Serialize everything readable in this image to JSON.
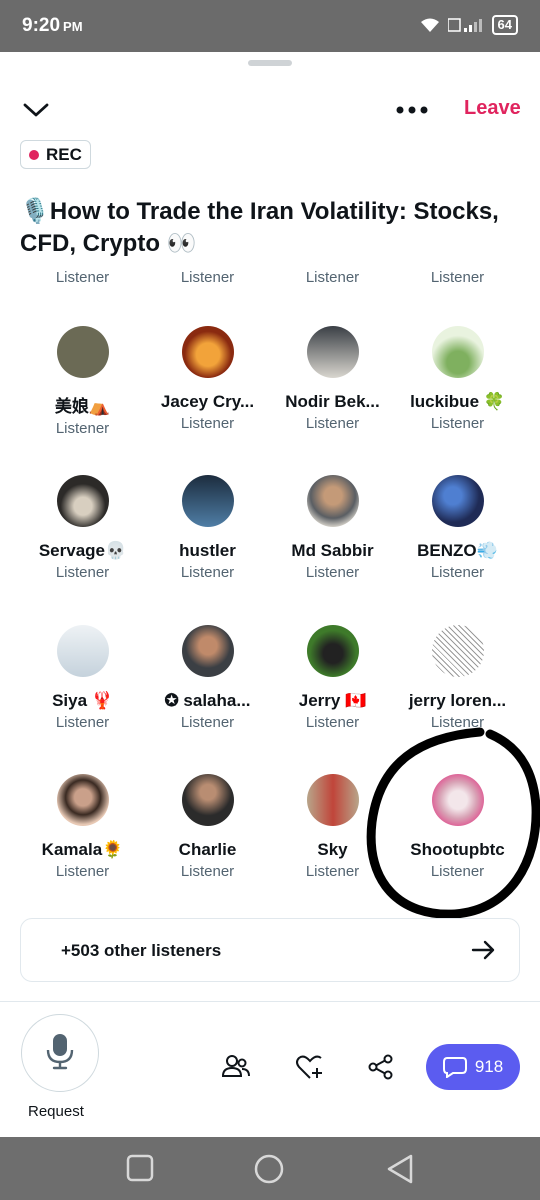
{
  "status": {
    "time": "9:20",
    "ampm": "PM",
    "battery": "64"
  },
  "header": {
    "leave_label": "Leave",
    "rec_label": "REC"
  },
  "space": {
    "title": "🎙️How to Trade the Iran Volatility: Stocks, CFD, Crypto 👀"
  },
  "partial_roles": [
    "Listener",
    "Listener",
    "Listener",
    "Listener"
  ],
  "listeners": [
    {
      "name": "美娘⛺",
      "role": "Listener",
      "color": "#6b6a55"
    },
    {
      "name": "Jacey Cry...",
      "role": "Listener",
      "color": "#8a2a10"
    },
    {
      "name": "Nodir Bek...",
      "role": "Listener",
      "color": "#3a3f45"
    },
    {
      "name": "luckibue 🍀",
      "role": "Listener",
      "color": "#c9e3b5"
    },
    {
      "name": "Servage💀",
      "role": "Listener",
      "color": "#2c2a28"
    },
    {
      "name": "hustler",
      "role": "Listener",
      "color": "#2f4f6b"
    },
    {
      "name": "Md Sabbir",
      "role": "Listener",
      "color": "#5a5e63"
    },
    {
      "name": "BENZO💨",
      "role": "Listener",
      "color": "#1f2b56"
    },
    {
      "name": "Siya 🦞",
      "role": "Listener",
      "color": "#d9e3ea"
    },
    {
      "name": "salaha...",
      "role": "Listener",
      "color": "#3b3f44"
    },
    {
      "name": "Jerry 🇨🇦",
      "role": "Listener",
      "color": "#3e7a2a"
    },
    {
      "name": "jerry loren...",
      "role": "Listener",
      "color": "#f0f0f0"
    },
    {
      "name": "Kamala🌻",
      "role": "Listener",
      "color": "#e8c9b5"
    },
    {
      "name": "Charlie",
      "role": "Listener",
      "color": "#2b2b2b"
    },
    {
      "name": "Sky",
      "role": "Listener",
      "color": "#b8a58a"
    },
    {
      "name": "Shootupbtc",
      "role": "Listener",
      "color": "#d8a2b5"
    }
  ],
  "others": {
    "label": "+503 other listeners"
  },
  "footer": {
    "request_label": "Request",
    "chat_count": "918"
  },
  "colors": {
    "accent_red": "#e0245e",
    "chat_button": "#5b5cf0",
    "secondary_text": "#536471"
  }
}
